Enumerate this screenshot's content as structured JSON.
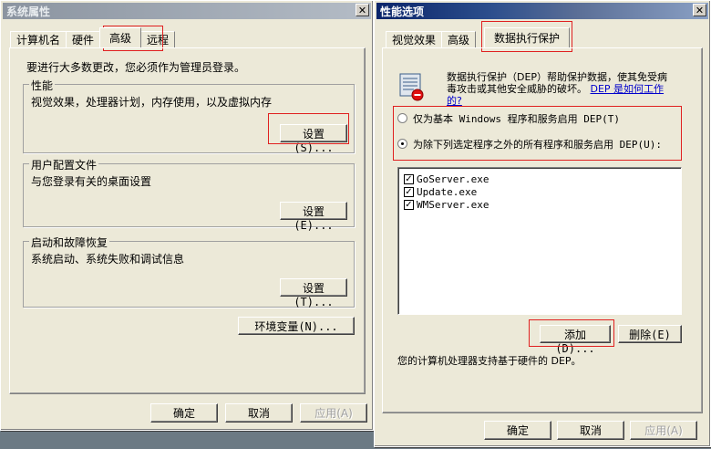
{
  "left_window": {
    "title": "系统属性",
    "close_glyph": "✕",
    "tabs": [
      "计算机名",
      "硬件",
      "高级",
      "远程"
    ],
    "active_tab": "高级",
    "intro": "要进行大多数更改，您必须作为管理员登录。",
    "groups": [
      {
        "label": "性能",
        "desc": "视觉效果，处理器计划，内存使用，以及虚拟内存",
        "button": "设置(S)..."
      },
      {
        "label": "用户配置文件",
        "desc": "与您登录有关的桌面设置",
        "button": "设置(E)..."
      },
      {
        "label": "启动和故障恢复",
        "desc": "系统启动、系统失败和调试信息",
        "button": "设置(T)..."
      }
    ],
    "env_button": "环境变量(N)...",
    "ok": "确定",
    "cancel": "取消",
    "apply": "应用(A)"
  },
  "right_window": {
    "title": "性能选项",
    "close_glyph": "✕",
    "tabs": [
      "视觉效果",
      "高级",
      "数据执行保护"
    ],
    "active_tab": "数据执行保护",
    "icon": "shield-dep-icon",
    "description_line1": "数据执行保护（DEP）帮助保护数据，使其免受病",
    "description_line2": "毒攻击或其他安全威胁的破坏。",
    "link_part1": "DEP 是如何工作",
    "link_part2": "的?",
    "option1": "仅为基本 Windows 程序和服务启用 DEP(T)",
    "option2": "为除下列选定程序之外的所有程序和服务启用 DEP(U):",
    "selected_option": 2,
    "programs": [
      {
        "name": "GoServer.exe",
        "checked": true
      },
      {
        "name": "Update.exe",
        "checked": true
      },
      {
        "name": "WMServer.exe",
        "checked": true
      }
    ],
    "add_button": "添加(D)...",
    "remove_button": "删除(E)",
    "hardware_note": "您的计算机处理器支持基于硬件的 DEP。",
    "ok": "确定",
    "cancel": "取消",
    "apply": "应用(A)"
  }
}
